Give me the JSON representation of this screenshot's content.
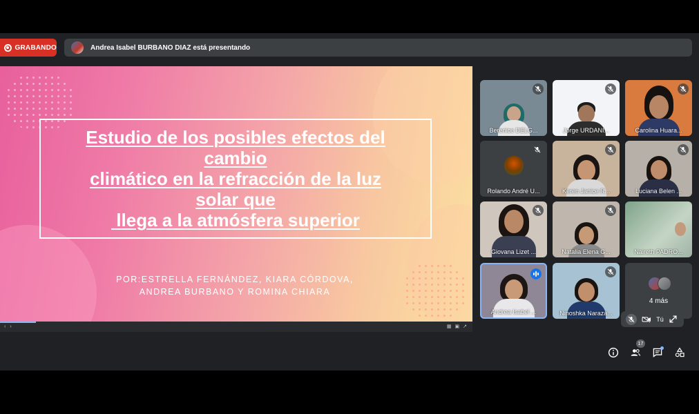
{
  "recording": {
    "label": "GRABANDO"
  },
  "presentation_bar": {
    "text": "Andrea Isabel BURBANO DIAZ está presentando"
  },
  "slide": {
    "title_lines": [
      "Estudio de los posibles efectos del",
      "cambio",
      "climático en la refracción de la luz",
      "solar que",
      " llega a la atmósfera superior"
    ],
    "author_lines": [
      "POR:ESTRELLA FERNÁNDEZ, KIARA CÓRDOVA,",
      "ANDREA BURBANO Y ROMINA CHIARA"
    ]
  },
  "participants": [
    {
      "name": "Berenice DELG...",
      "muted": true
    },
    {
      "name": "Jorge URDANI...",
      "muted": true
    },
    {
      "name": "Carolina Huara...",
      "muted": true
    },
    {
      "name": "Rolando André U...",
      "muted": true
    },
    {
      "name": "Keren Janice R...",
      "muted": true
    },
    {
      "name": "Luciana Belen ...",
      "muted": true
    },
    {
      "name": "Giovana Lizet ...",
      "muted": true
    },
    {
      "name": "Natalia Elena G...",
      "muted": true
    },
    {
      "name": "Naireth PADRO...",
      "muted": false
    },
    {
      "name": "Andrea Isabel ...",
      "muted": false,
      "speaking": true
    },
    {
      "name": "Ninoshka Naraza...",
      "muted": true
    }
  ],
  "more_tile": {
    "label": "4 más"
  },
  "self_view": {
    "label": "Tú"
  },
  "controls": {
    "people_count": "17"
  },
  "colors": {
    "record": "#d93025",
    "accent": "#8ab4f8",
    "background": "#202124"
  }
}
